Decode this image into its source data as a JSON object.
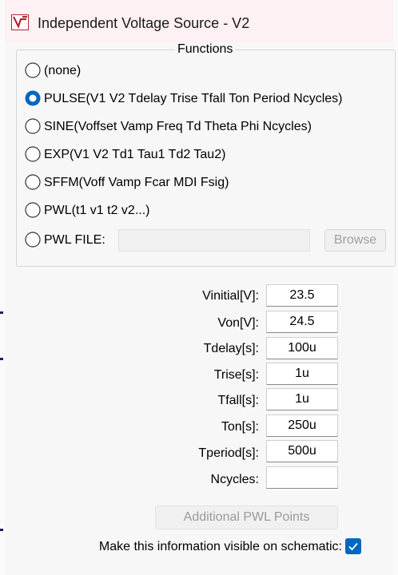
{
  "window": {
    "title": "Independent Voltage Source - V2"
  },
  "functions": {
    "group_title": "Functions",
    "options": [
      {
        "label": "(none)",
        "selected": false
      },
      {
        "label": "PULSE(V1 V2 Tdelay Trise Tfall Ton Period Ncycles)",
        "selected": true
      },
      {
        "label": "SINE(Voffset Vamp Freq Td Theta Phi Ncycles)",
        "selected": false
      },
      {
        "label": "EXP(V1 V2 Td1 Tau1 Td2 Tau2)",
        "selected": false
      },
      {
        "label": "SFFM(Voff Vamp Fcar MDI Fsig)",
        "selected": false
      },
      {
        "label": "PWL(t1 v1 t2 v2...)",
        "selected": false
      },
      {
        "label": "PWL FILE:",
        "selected": false
      }
    ],
    "pwl_file_value": "",
    "browse_label": "Browse"
  },
  "params": [
    {
      "label": "Vinitial[V]:",
      "value": "23.5"
    },
    {
      "label": "Von[V]:",
      "value": "24.5"
    },
    {
      "label": "Tdelay[s]:",
      "value": "100u"
    },
    {
      "label": "Trise[s]:",
      "value": "1u"
    },
    {
      "label": "Tfall[s]:",
      "value": "1u"
    },
    {
      "label": "Ton[s]:",
      "value": "250u"
    },
    {
      "label": "Tperiod[s]:",
      "value": "500u"
    },
    {
      "label": "Ncycles:",
      "value": ""
    }
  ],
  "additional_pwl_label": "Additional PWL Points",
  "visible_on_schematic": {
    "label": "Make this information visible on schematic:",
    "checked": true
  },
  "colors": {
    "accent": "#0067c0",
    "titlebar_bg": "#fdf1f3",
    "client_bg": "#f7f7f7"
  },
  "icons": {
    "app": "ltspice-logo-icon",
    "check": "checkmark-icon"
  }
}
